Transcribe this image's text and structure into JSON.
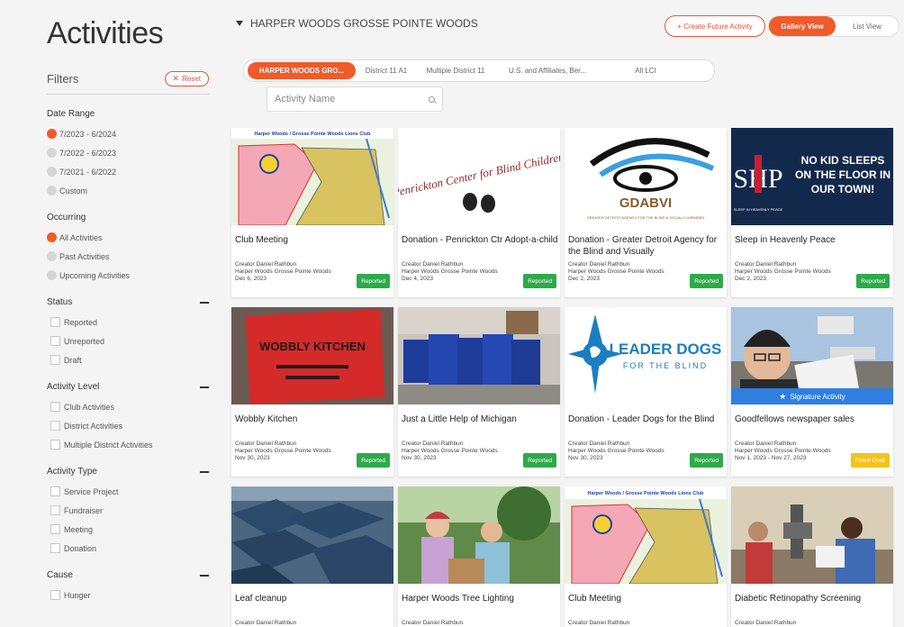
{
  "page": {
    "title": "Activities"
  },
  "filters": {
    "label": "Filters",
    "reset_label": "Reset",
    "date_range": {
      "title": "Date Range",
      "options": [
        "7/2023 - 6/2024",
        "7/2022 - 6/2023",
        "7/2021 - 6/2022",
        "Custom"
      ]
    },
    "occurring": {
      "title": "Occurring",
      "options": [
        "All Activities",
        "Past Activities",
        "Upcoming Activities"
      ]
    },
    "status": {
      "title": "Status",
      "options": [
        "Reported",
        "Unreported",
        "Draft"
      ]
    },
    "activity_level": {
      "title": "Activity Level",
      "options": [
        "Club Activities",
        "District Activities",
        "Multiple District Activities"
      ]
    },
    "activity_type": {
      "title": "Activity Type",
      "options": [
        "Service Project",
        "Fundraiser",
        "Meeting",
        "Donation"
      ]
    },
    "cause": {
      "title": "Cause",
      "options": [
        "Hunger"
      ]
    }
  },
  "header": {
    "club_name": "HARPER WOODS GROSSE POINTE WOODS",
    "create_label": "+ Create Future Activity",
    "gallery_label": "Gallery View",
    "list_label": "List View"
  },
  "tabs": [
    "HARPER WOODS GRO...",
    "District 11 A1",
    "Multiple District 11",
    "U.S. and Affiliates, Ber...",
    "All LCI"
  ],
  "search": {
    "placeholder": "Activity Name"
  },
  "images": {
    "lions_club_text": "Harper Woods / Grosse Pointe Woods Lions Club",
    "penrickton_text": "Penrickton Center for Blind Children",
    "gdabvi_name": "GDABVI",
    "gdabvi_sub": "GREATER DETROIT AGENCY FOR THE BLIND & VISUALLY IMPAIRED",
    "shp_logo": "SHP",
    "shp_tag": "SLEEP IN HEAVENLY PEACE",
    "shp_message": "NO KID SLEEPS ON THE FLOOR IN OUR TOWN!",
    "wobbly_sign": "WOBBLY KITCHEN",
    "leader_dogs_name": "LEADER DOGS",
    "leader_dogs_sub": "FOR THE BLIND"
  },
  "cards": [
    {
      "title": "Club Meeting",
      "creator": "Creator Daniel Rathbun",
      "club": "Harper Woods Grosse Pointe Woods",
      "date": "Dec 6, 2023",
      "status": "Reported"
    },
    {
      "title": "Donation - Penrickton Ctr Adopt-a-child",
      "creator": "Creator Daniel Rathbun",
      "club": "Harper Woods Grosse Pointe Woods",
      "date": "Dec 4, 2023",
      "status": "Reported"
    },
    {
      "title": "Donation - Greater Detroit Agency for the Blind and Visually",
      "creator": "Creator Daniel Rathbun",
      "club": "Harper Woods Grosse Pointe Woods",
      "date": "Dec 2, 2023",
      "status": "Reported"
    },
    {
      "title": "Sleep in Heavenly Peace",
      "creator": "Creator Daniel Rathbun",
      "club": "Harper Woods Grosse Pointe Woods",
      "date": "Dec 2, 2023",
      "status": "Reported"
    },
    {
      "title": "Wobbly Kitchen",
      "creator": "Creator Daniel Rathbun",
      "club": "Harper Woods Grosse Pointe Woods",
      "date": "Nov 30, 2023",
      "status": "Reported"
    },
    {
      "title": "Just a Little Help of Michigan",
      "creator": "Creator Daniel Rathbun",
      "club": "Harper Woods Grosse Pointe Woods",
      "date": "Nov 30, 2023",
      "status": "Reported"
    },
    {
      "title": "Donation - Leader Dogs for the Blind",
      "creator": "Creator Daniel Rathbun",
      "club": "Harper Woods Grosse Pointe Woods",
      "date": "Nov 30, 2023",
      "status": "Reported"
    },
    {
      "title": "Goodfellows newspaper sales",
      "creator": "Creator Daniel Rathbun",
      "club": "Harper Woods Grosse Pointe Woods",
      "date": "Nov 1, 2023 - Nov 27, 2023",
      "status": "Finish Draft",
      "signature": "Signature Activity"
    },
    {
      "title": "Leaf cleanup",
      "creator": "Creator Daniel Rathbun"
    },
    {
      "title": "Harper Woods Tree Lighting",
      "creator": "Creator Daniel Rathbun"
    },
    {
      "title": "Club Meeting",
      "creator": "Creator Daniel Rathbun"
    },
    {
      "title": "Diabetic Retinopathy Screening",
      "creator": "Creator Daniel Rathbun"
    }
  ],
  "colors": {
    "accent": "#f15a29",
    "reported": "#2eaa4a",
    "draft": "#f5c21b",
    "signature": "#2f7fe0"
  }
}
